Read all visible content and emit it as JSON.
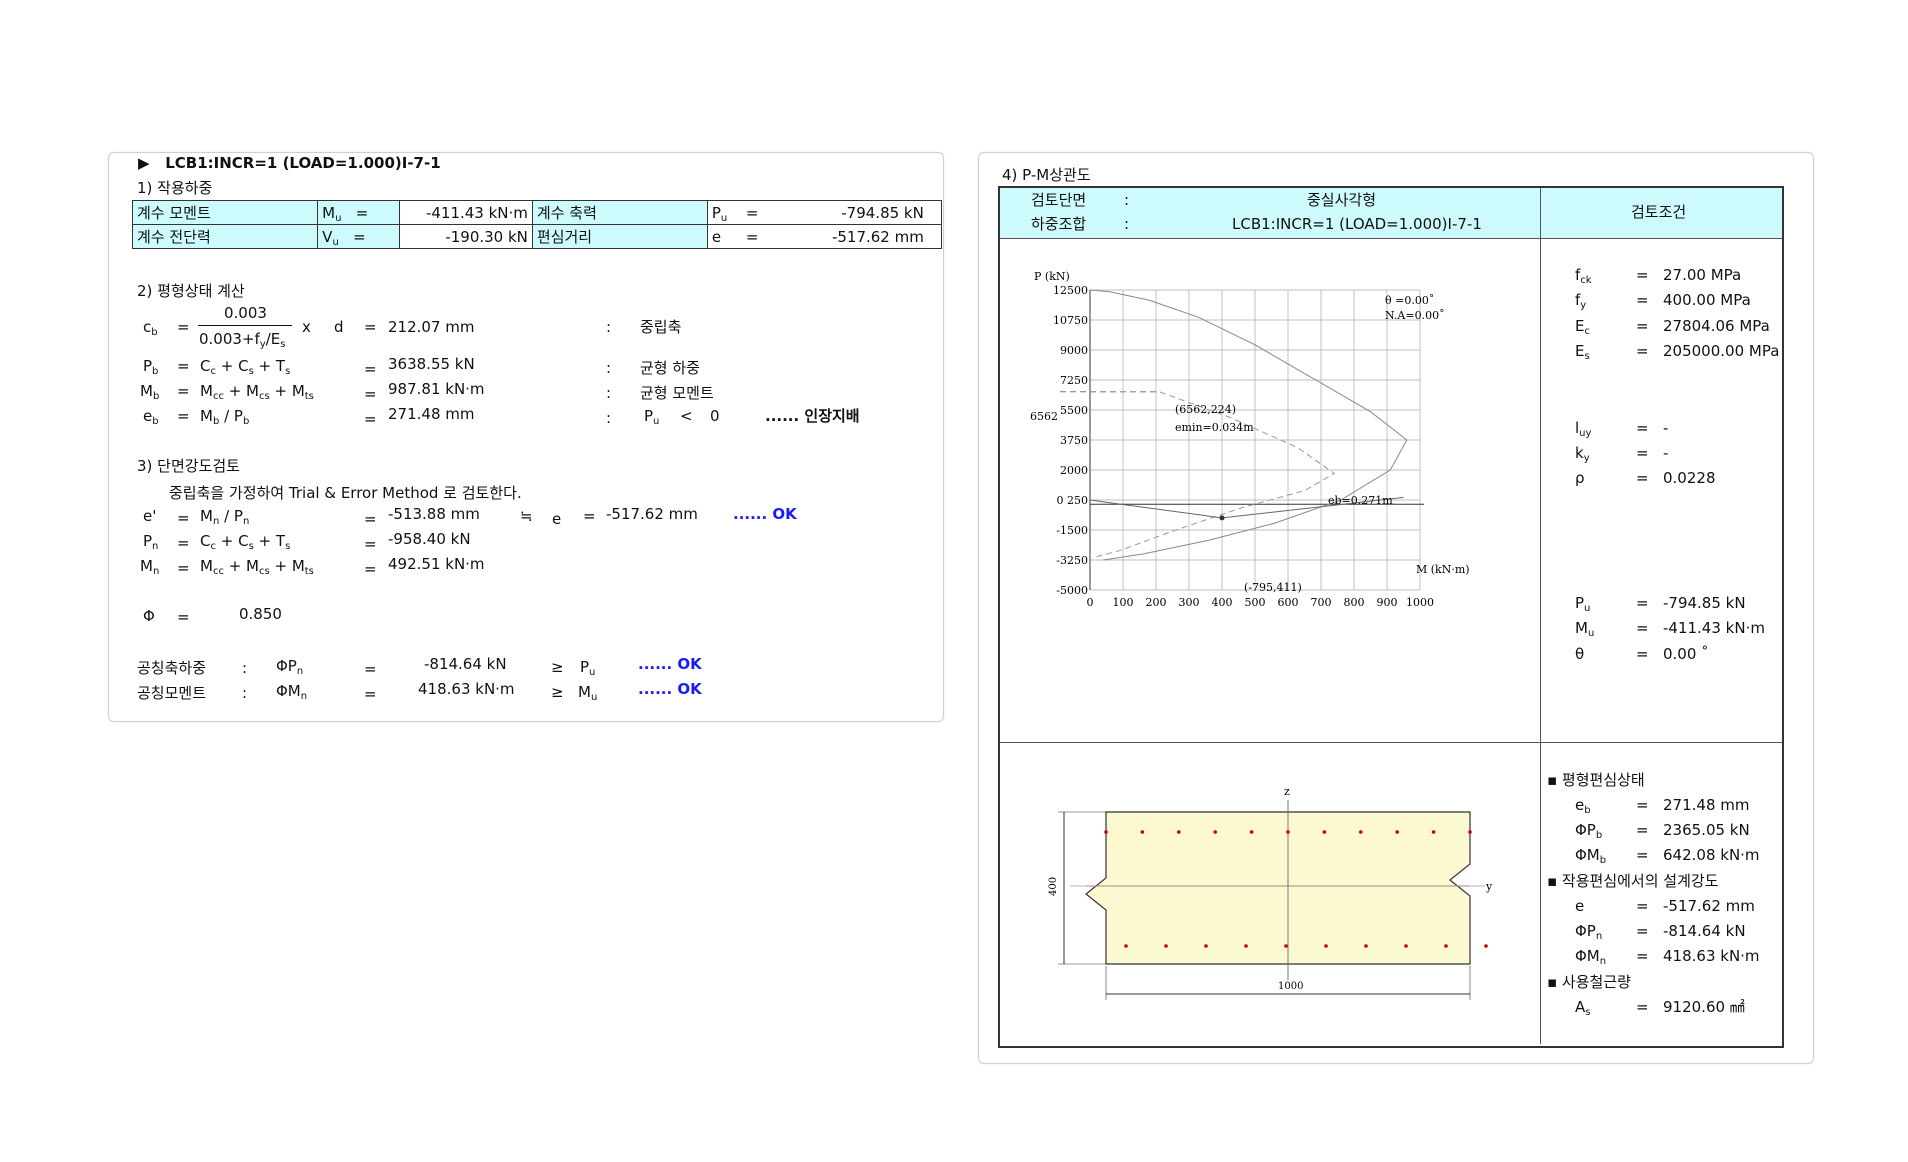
{
  "left": {
    "header": "LCB1:INCR=1 (LOAD=1.000)I-7-1",
    "s1": {
      "title": "1) 작용하중",
      "rows": [
        [
          "계수 모멘트",
          "M",
          "u",
          "=",
          "-411.43 kN·m",
          "계수 축력",
          "P",
          "u",
          "=",
          "-794.85 kN"
        ],
        [
          "계수 전단력",
          "V",
          "u",
          "=",
          "-190.30 kN",
          "편심거리",
          "e",
          "",
          "=",
          "-517.62 mm"
        ]
      ]
    },
    "s2": {
      "title": "2) 평형상태 계산",
      "cb": {
        "lhs": "c",
        "lsub": "b",
        "eq": "=",
        "num": "0.003",
        "den_a": "0.003+f",
        "den_sub1": "y",
        "den_b": "/E",
        "den_sub2": "s",
        "times": "x",
        "d": "d",
        "eq2": "=",
        "value": "212.07 mm",
        "colon": ":",
        "desc": "중립축"
      },
      "pb": {
        "lhs": "P",
        "lsub": "b",
        "eq": "=",
        "f1": "C",
        "s1": "c",
        "f2": " + C",
        "s2": "s",
        "f3": " + T",
        "s3": "s",
        "eq2": "=",
        "value": "3638.55 kN",
        "colon": ":",
        "desc": "균형 하중"
      },
      "mb": {
        "lhs": "M",
        "lsub": "b",
        "eq": "=",
        "f1": "M",
        "s1": "cc",
        "f2": " + M",
        "s2": "cs",
        "f3": " + M",
        "s3": "ts",
        "eq2": "=",
        "value": "987.81 kN·m",
        "colon": ":",
        "desc": "균형 모멘트"
      },
      "eb": {
        "lhs": "e",
        "lsub": "b",
        "eq": "=",
        "f1": "M",
        "s1": "b",
        "f2": " / P",
        "s2": "b",
        "eq2": "=",
        "value": "271.48 mm",
        "colon": ":",
        "pu": "P",
        "pusub": "u",
        "lt": "<",
        "zero": "0",
        "result": "...... 인장지배"
      }
    },
    "s3": {
      "title": "3) 단면강도검토",
      "note": "중립축을 가정하여 Trial & Error Method 로 검토한다.",
      "ep": {
        "lhs": "e'",
        "eq": "=",
        "f1": "M",
        "s1": "n",
        "f2": " / P",
        "s2": "n",
        "eq2": "=",
        "value": "-513.88 mm",
        "approx": "≒",
        "e": "e",
        "eq3": "=",
        "evalue": "-517.62 mm",
        "ok": "...... OK"
      },
      "pn": {
        "lhs": "P",
        "lsub": "n",
        "eq": "=",
        "f1": "C",
        "s1": "c",
        "f2": " + C",
        "s2": "s",
        "f3": " + T",
        "s3": "s",
        "eq2": "=",
        "value": "-958.40 kN"
      },
      "mn": {
        "lhs": "M",
        "lsub": "n",
        "eq": "=",
        "f1": "M",
        "s1": "cc",
        "f2": " + M",
        "s2": "cs",
        "f3": " + M",
        "s3": "ts",
        "eq2": "=",
        "value": "492.51 kN·m"
      },
      "phi": {
        "lhs": "Φ",
        "eq": "=",
        "value": "0.850"
      },
      "axial": {
        "label": "공칭축하중",
        "colon": ":",
        "sym": "ΦP",
        "sub": "n",
        "eq": "=",
        "value": "-814.64 kN",
        "ge": "≥",
        "cmp": "P",
        "cmpsub": "u",
        "ok": "...... OK"
      },
      "moment": {
        "label": "공칭모멘트",
        "colon": ":",
        "sym": "ΦM",
        "sub": "n",
        "eq": "=",
        "value": "418.63 kN·m",
        "ge": "≥",
        "cmp": "M",
        "cmpsub": "u",
        "ok": "...... OK"
      }
    }
  },
  "right": {
    "title": "4) P-M상관도",
    "head": {
      "l1": "검토단면",
      "c1": ":",
      "v1": "중실사각형",
      "l2": "하중조합",
      "c2": ":",
      "v2": "LCB1:INCR=1 (LOAD=1.000)I-7-1",
      "cond": "검토조건"
    },
    "mat": [
      {
        "s": "f",
        "b": "ck",
        "eq": "=",
        "v": "27.00 MPa"
      },
      {
        "s": "f",
        "b": "y",
        "eq": "=",
        "v": "400.00 MPa"
      },
      {
        "s": "E",
        "b": "c",
        "eq": "=",
        "v": "27804.06 MPa"
      },
      {
        "s": "E",
        "b": "s",
        "eq": "=",
        "v": "205000.00 MPa"
      }
    ],
    "geo": [
      {
        "s": "l",
        "b": "uy",
        "eq": "=",
        "v": "-"
      },
      {
        "s": "k",
        "b": "y",
        "eq": "=",
        "v": "-"
      },
      {
        "s": "ρ",
        "b": "",
        "eq": "=",
        "v": "0.0228"
      }
    ],
    "load": [
      {
        "s": "P",
        "b": "u",
        "eq": "=",
        "v": "-794.85 kN"
      },
      {
        "s": "M",
        "b": "u",
        "eq": "=",
        "v": "-411.43 kN·m"
      },
      {
        "s": "θ",
        "b": "",
        "eq": "=",
        "v": "0.00 ˚"
      }
    ],
    "bal_title": "▪ 평형편심상태",
    "bal": [
      {
        "s": "e",
        "b": "b",
        "eq": "=",
        "v": "271.48 mm"
      },
      {
        "s": "ΦP",
        "b": "b",
        "eq": "=",
        "v": "2365.05 kN"
      },
      {
        "s": "ΦM",
        "b": "b",
        "eq": "=",
        "v": "642.08 kN·m"
      }
    ],
    "des_title": "▪ 작용편심에서의 설계강도",
    "des": [
      {
        "s": "e",
        "b": "",
        "eq": "=",
        "v": "-517.62 mm"
      },
      {
        "s": "ΦP",
        "b": "n",
        "eq": "=",
        "v": "-814.64 kN"
      },
      {
        "s": "ΦM",
        "b": "n",
        "eq": "=",
        "v": "418.63 kN·m"
      }
    ],
    "steel_title": "▪ 사용철근량",
    "steel": [
      {
        "s": "A",
        "b": "s",
        "eq": "=",
        "v": "9120.60 ㎟"
      }
    ],
    "section": {
      "z": "z",
      "y": "y",
      "dim_h": "400",
      "dim_w": "1000"
    }
  },
  "chart_data": {
    "type": "line",
    "xlabel": "M (kN·m)",
    "ylabel": "P (kN)",
    "xlim": [
      0,
      1000
    ],
    "ylim": [
      -5000,
      12500
    ],
    "xticks": [
      0,
      100,
      200,
      300,
      400,
      500,
      600,
      700,
      800,
      900,
      1000
    ],
    "yticks": [
      12500,
      10750,
      9000,
      7250,
      5500,
      3750,
      2000,
      250,
      -1500,
      -3250,
      -5000
    ],
    "ytick_labels": [
      "12500",
      "10750",
      "9000",
      "7250",
      "5500",
      "3750",
      "2000",
      "0 250",
      "-1500",
      "-3250",
      "-5000"
    ],
    "grid": true,
    "annotations": {
      "theta": "θ  =0.00˚",
      "na": "N.A=0.00˚",
      "balanced": "(6562,224)",
      "emin": "emin=0.034m",
      "eb": "eb=0.271m",
      "load_pt": "(-795,411)",
      "p_ref": "6562"
    },
    "series": [
      {
        "values_x": [
          0,
          60,
          180,
          330,
          500,
          680,
          850,
          960,
          910,
          760,
          560,
          360,
          160,
          40
        ],
        "values_y": [
          12500,
          12400,
          11900,
          10900,
          9300,
          7300,
          5400,
          3750,
          2000,
          250,
          -1100,
          -2100,
          -2900,
          -3250
        ]
      },
      {
        "values_x": [
          0,
          210,
          420,
          630,
          740,
          650,
          460,
          260,
          90,
          10
        ],
        "values_y": [
          6562,
          6562,
          5100,
          3300,
          1800,
          800,
          -200,
          -1500,
          -2700,
          -3100
        ]
      },
      {
        "values_x": [
          0,
          400,
          950
        ],
        "values_y": [
          250,
          -795,
          400
        ]
      }
    ]
  }
}
